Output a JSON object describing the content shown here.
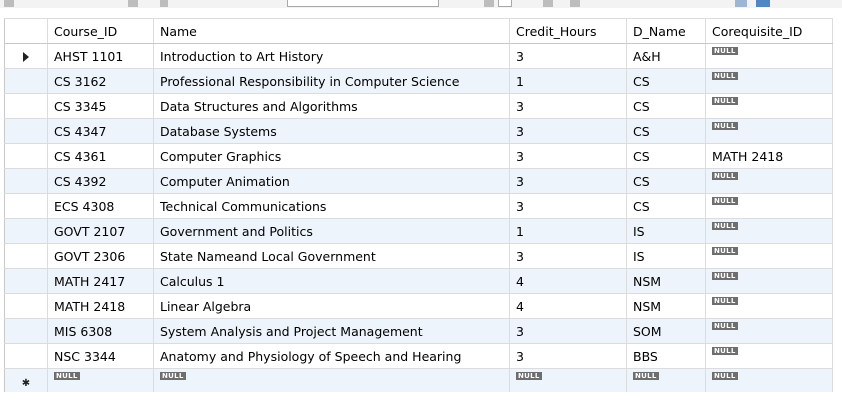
{
  "grid": {
    "columns": [
      "Course_ID",
      "Name",
      "Credit_Hours",
      "D_Name",
      "Corequisite_ID"
    ],
    "null_label": "NULL",
    "rows": [
      [
        "AHST 1101",
        "Introduction to Art History",
        "3",
        "A&H",
        null
      ],
      [
        "CS 3162",
        "Professional Responsibility in Computer Science",
        "1",
        "CS",
        null
      ],
      [
        "CS 3345",
        "Data Structures and Algorithms",
        "3",
        "CS",
        null
      ],
      [
        "CS 4347",
        "Database Systems",
        "3",
        "CS",
        null
      ],
      [
        "CS 4361",
        "Computer Graphics",
        "3",
        "CS",
        "MATH 2418"
      ],
      [
        "CS 4392",
        "Computer Animation",
        "3",
        "CS",
        null
      ],
      [
        "ECS 4308",
        "Technical Communications",
        "3",
        "CS",
        null
      ],
      [
        "GOVT 2107",
        "Government and Politics",
        "1",
        "IS",
        null
      ],
      [
        "GOVT 2306",
        "State Nameand Local Government",
        "3",
        "IS",
        null
      ],
      [
        "MATH 2417",
        "Calculus 1",
        "4",
        "NSM",
        null
      ],
      [
        "MATH 2418",
        "Linear Algebra",
        "4",
        "NSM",
        null
      ],
      [
        "MIS 6308",
        "System Analysis and Project Management",
        "3",
        "SOM",
        null
      ],
      [
        "NSC 3344",
        "Anatomy and Physiology of Speech and Hearing",
        "3",
        "BBS",
        null
      ]
    ]
  }
}
